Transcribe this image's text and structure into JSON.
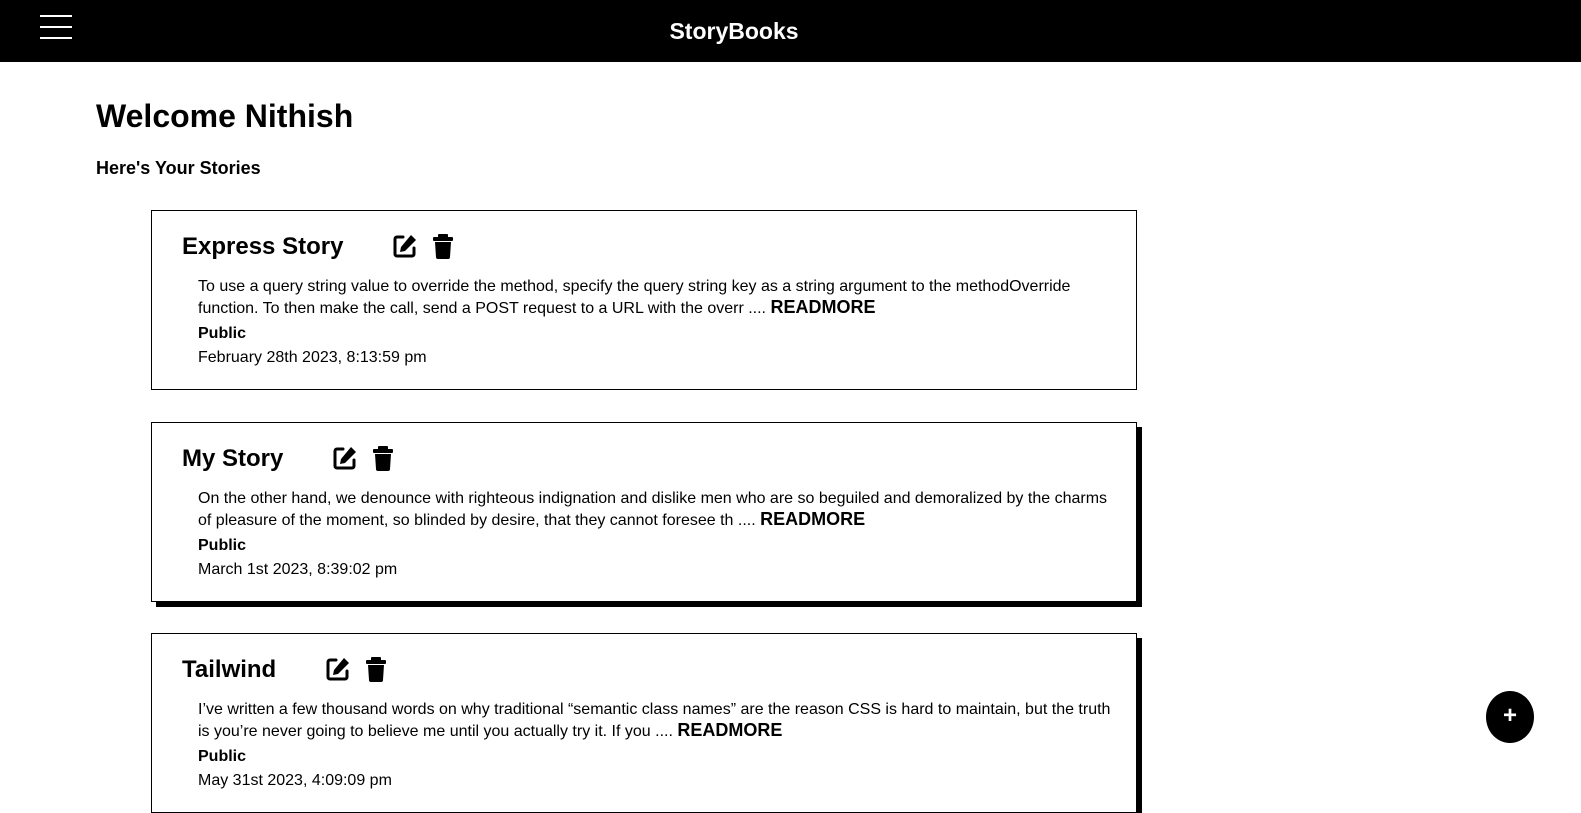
{
  "header": {
    "brand": "StoryBooks",
    "menu_icon": "hamburger-menu-icon"
  },
  "dashboard": {
    "welcome": "Welcome Nithish",
    "subtitle": "Here's Your Stories"
  },
  "stories": [
    {
      "title": "Express Story",
      "excerpt": "To use a query string value to override the method, specify the query string key as a string argument to the methodOverride function. To then make the call, send a POST request to a URL with the overr ....",
      "readmore": "READMORE",
      "status": "Public",
      "date": "February 28th 2023, 8:13:59 pm",
      "edit_icon": "edit-icon",
      "delete_icon": "trash-icon"
    },
    {
      "title": "My Story",
      "excerpt": "On the other hand, we denounce with righteous indignation and dislike men who are so beguiled and demoralized by the charms of pleasure of the moment, so blinded by desire, that they cannot foresee th ....",
      "readmore": "READMORE",
      "status": "Public",
      "date": "March 1st 2023, 8:39:02 pm",
      "edit_icon": "edit-icon",
      "delete_icon": "trash-icon"
    },
    {
      "title": "Tailwind",
      "excerpt": "I’ve written a few thousand words on why traditional “semantic class names” are the reason CSS is hard to maintain, but the truth is you’re never going to believe me until you actually try it. If you ....",
      "readmore": "READMORE",
      "status": "Public",
      "date": "May 31st 2023, 4:09:09 pm",
      "edit_icon": "edit-icon",
      "delete_icon": "trash-icon"
    }
  ],
  "fab": {
    "label": "+",
    "icon": "plus-icon"
  },
  "colors": {
    "topbar": "#000000",
    "background": "#ffffff",
    "text": "#000000"
  }
}
